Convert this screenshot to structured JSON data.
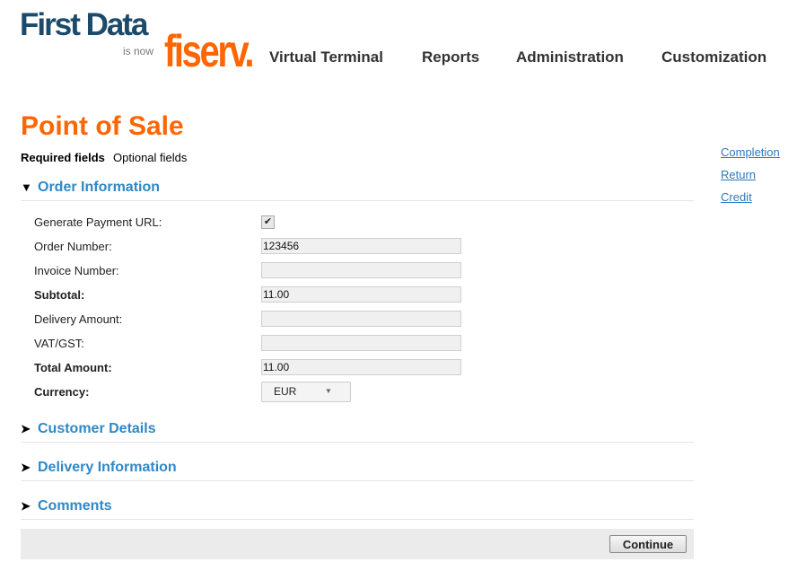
{
  "logo": {
    "brand": "First Data",
    "is_now": "is now",
    "new_brand": "fiserv."
  },
  "nav": [
    "Virtual Terminal",
    "Reports",
    "Administration",
    "Customization"
  ],
  "page": {
    "title": "Point of Sale",
    "required": "Required fields",
    "optional": "Optional fields"
  },
  "sections": {
    "order": "Order Information",
    "customer": "Customer Details",
    "delivery": "Delivery Information",
    "comments": "Comments"
  },
  "fields": {
    "generate_url": {
      "label": "Generate Payment URL:",
      "checked": true
    },
    "order_number": {
      "label": "Order Number:",
      "value": "123456"
    },
    "invoice_number": {
      "label": "Invoice Number:",
      "value": ""
    },
    "subtotal": {
      "label": "Subtotal:",
      "value": "11.00"
    },
    "delivery_amount": {
      "label": "Delivery Amount:",
      "value": ""
    },
    "vat": {
      "label": "VAT/GST:",
      "value": ""
    },
    "total": {
      "label": "Total Amount:",
      "value": "11.00"
    },
    "currency": {
      "label": "Currency:",
      "value": "EUR"
    }
  },
  "side_links": [
    "Completion",
    "Return",
    "Credit"
  ],
  "footer": {
    "continue": "Continue"
  },
  "colors": {
    "accent": "#ff6600",
    "link": "#2f88c6",
    "brand_dark": "#1b4a6b"
  }
}
